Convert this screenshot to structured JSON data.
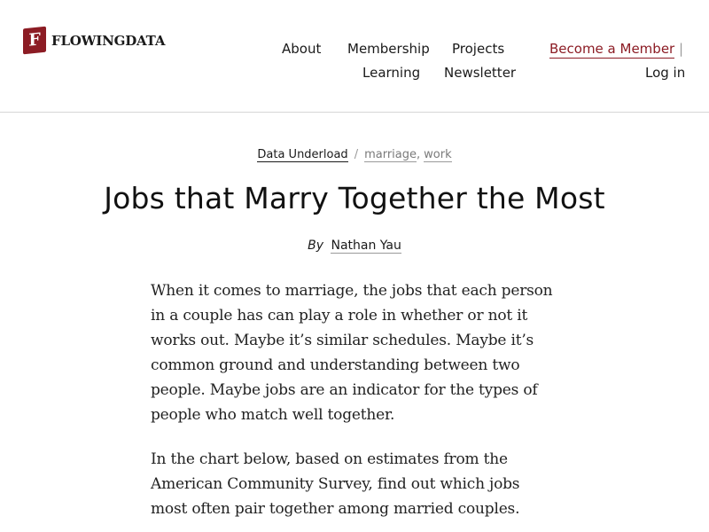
{
  "header": {
    "logo_mark": "F",
    "logo_text": "FLOWINGDATA",
    "nav": {
      "about": "About",
      "membership": "Membership",
      "projects": "Projects",
      "learning": "Learning",
      "newsletter": "Newsletter",
      "become_member": "Become a Member",
      "separator": "|",
      "login": "Log in"
    }
  },
  "article": {
    "category": "Data Underload",
    "crumb_separator": "/",
    "tags": [
      "marriage",
      "work"
    ],
    "tag_separator": ",",
    "title": "Jobs that Marry Together the Most",
    "byline_prefix": "By",
    "author": "Nathan Yau",
    "paragraphs": [
      "When it comes to marriage, the jobs that each person in a couple has can play a role in whether or not it works out. Maybe it’s similar schedules. Maybe it’s common ground and understanding between two people. Maybe jobs are an indicator for the types of people who match well together.",
      "In the chart below, based on estimates from the American Community Survey, find out which jobs most often pair together among married couples."
    ]
  },
  "colors": {
    "brand": "#8c1c24",
    "text": "#1a1a1a",
    "muted": "#9a9a9a"
  }
}
